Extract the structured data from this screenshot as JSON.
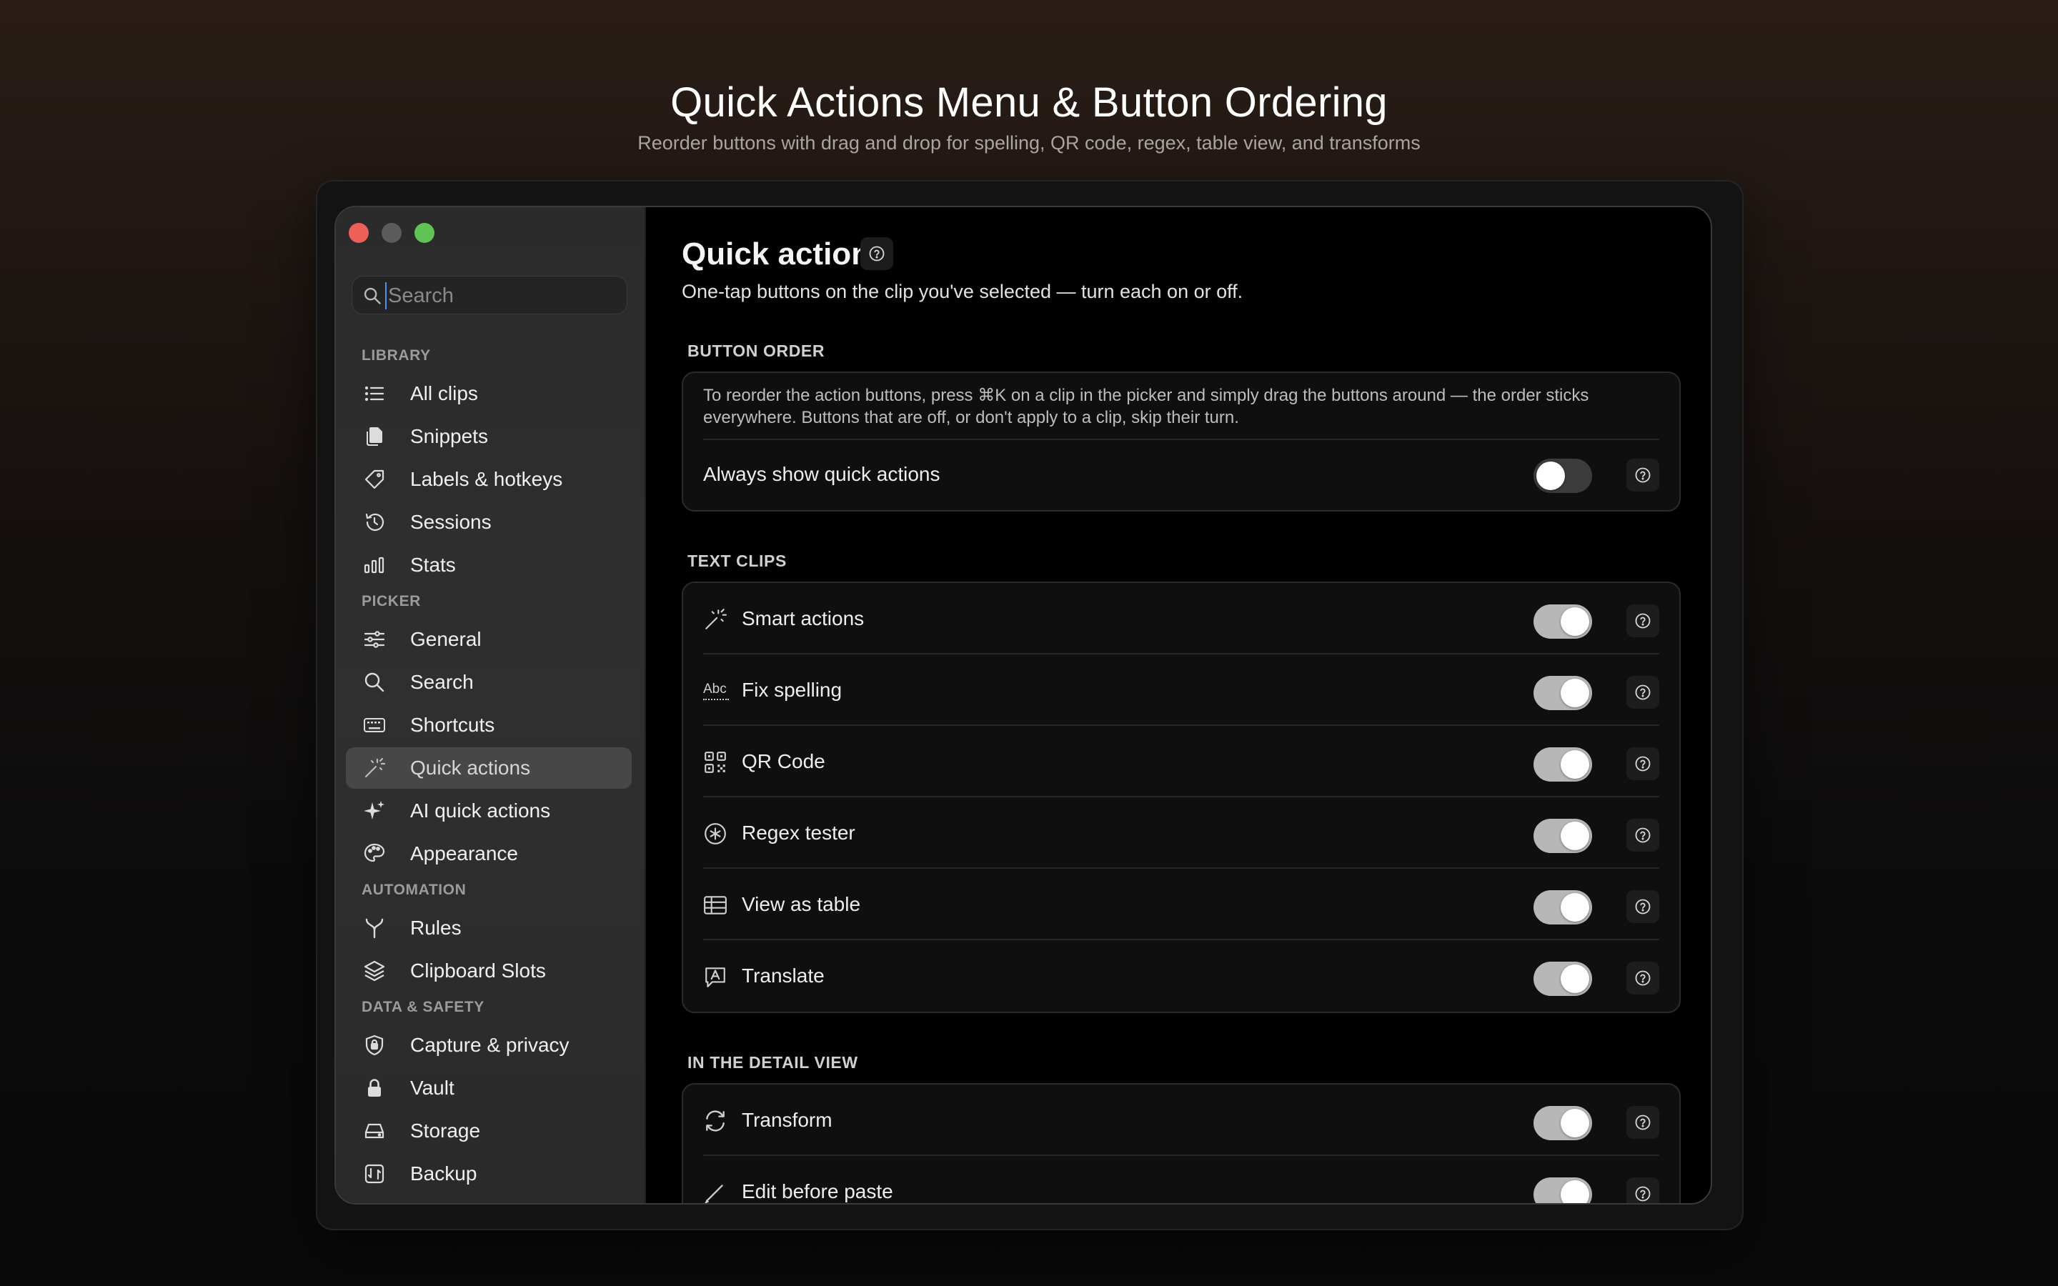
{
  "hero": {
    "title": "Quick Actions Menu & Button Ordering",
    "subtitle": "Reorder buttons with drag and drop for spelling, QR code, regex, table view, and transforms"
  },
  "sidebar": {
    "search_placeholder": "Search",
    "sections": {
      "library": "LIBRARY",
      "picker": "PICKER",
      "automation": "AUTOMATION",
      "data_safety": "DATA & SAFETY"
    },
    "items": {
      "all_clips": "All clips",
      "snippets": "Snippets",
      "labels_hotkeys": "Labels & hotkeys",
      "sessions": "Sessions",
      "stats": "Stats",
      "general": "General",
      "search": "Search",
      "shortcuts": "Shortcuts",
      "quick_actions": "Quick actions",
      "ai_quick_actions": "AI quick actions",
      "appearance": "Appearance",
      "rules": "Rules",
      "clipboard_slots": "Clipboard Slots",
      "capture_privacy": "Capture & privacy",
      "vault": "Vault",
      "storage": "Storage",
      "backup": "Backup"
    },
    "active_item": "Quick actions"
  },
  "main": {
    "title": "Quick actions",
    "description": "One-tap buttons on the clip you've selected — turn each on or off.",
    "button_order": {
      "label": "BUTTON ORDER",
      "note": "To reorder the action buttons, press ⌘K on a clip in the picker and simply drag the buttons around — the order sticks everywhere. Buttons that are off, or don't apply to a clip, skip their turn.",
      "always_show": {
        "label": "Always show quick actions",
        "on": false
      }
    },
    "text_clips": {
      "label": "TEXT CLIPS",
      "rows": {
        "smart_actions": {
          "label": "Smart actions",
          "on": true,
          "icon": "magic-wand-icon"
        },
        "fix_spelling": {
          "label": "Fix spelling",
          "on": true,
          "icon": "spellcheck-icon",
          "icon_text": "Abc"
        },
        "qr_code": {
          "label": "QR Code",
          "on": true,
          "icon": "qr-code-icon"
        },
        "regex_tester": {
          "label": "Regex tester",
          "on": true,
          "icon": "asterisk-circle-icon"
        },
        "view_as_table": {
          "label": "View as table",
          "on": true,
          "icon": "table-icon"
        },
        "translate": {
          "label": "Translate",
          "on": true,
          "icon": "translate-icon"
        }
      }
    },
    "detail_view": {
      "label": "IN THE DETAIL VIEW",
      "rows": {
        "transform": {
          "label": "Transform",
          "on": true,
          "icon": "refresh-arrows-icon"
        },
        "edit_before_paste": {
          "label": "Edit before paste",
          "on": true,
          "icon": "pencil-icon"
        }
      }
    }
  },
  "colors": {
    "toggle_on": "#b7b7b7",
    "toggle_off": "#3c3c3c",
    "sidebar_active": "#474747",
    "close": "#ee5f58",
    "minimize": "#5b5b5b",
    "maximize": "#5fc454"
  }
}
